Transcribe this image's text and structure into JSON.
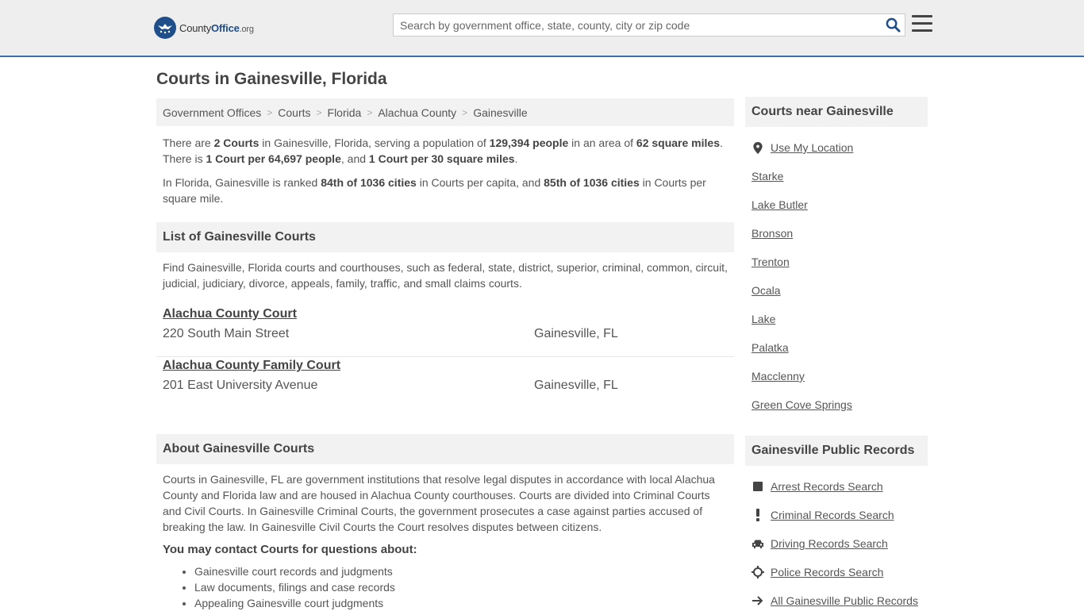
{
  "header": {
    "logo": {
      "name": "County",
      "accent": "Office",
      "tld": ".org"
    },
    "search": {
      "placeholder": "Search by government office, state, county, city or zip code",
      "value": ""
    }
  },
  "page_title": "Courts in Gainesville, Florida",
  "breadcrumb": [
    "Government Offices",
    "Courts",
    "Florida",
    "Alachua County",
    "Gainesville"
  ],
  "intro": {
    "p1": {
      "t1": "There are ",
      "b1": "2 Courts",
      "t2": " in Gainesville, Florida, serving a population of ",
      "b2": "129,394 people",
      "t3": " in an area of ",
      "b3": "62 square miles",
      "t4": ". There is ",
      "b4": "1 Court per 64,697 people",
      "t5": ", and ",
      "b5": "1 Court per 30 square miles",
      "t6": "."
    },
    "p2": {
      "t1": "In Florida, Gainesville is ranked ",
      "b1": "84th of 1036 cities",
      "t2": " in Courts per capita, and ",
      "b2": "85th of 1036 cities",
      "t3": " in Courts per square mile."
    }
  },
  "list_section": {
    "heading": "List of Gainesville Courts",
    "description": "Find Gainesville, Florida courts and courthouses, such as federal, state, district, superior, criminal, common, circuit, judicial, judiciary, divorce, appeals, family, traffic, and small claims courts.",
    "courts": [
      {
        "name": "Alachua County Court",
        "address": "220 South Main Street",
        "city": "Gainesville, FL"
      },
      {
        "name": "Alachua County Family Court",
        "address": "201 East University Avenue",
        "city": "Gainesville, FL"
      }
    ]
  },
  "about_section": {
    "heading": "About Gainesville Courts",
    "text": "Courts in Gainesville, FL are government institutions that resolve legal disputes in accordance with local Alachua County and Florida law and are housed in Alachua County courthouses. Courts are divided into Criminal Courts and Civil Courts. In Gainesville Criminal Courts, the government prosecutes a case against parties accused of breaking the law. In Gainesville Civil Courts the Court resolves disputes between citizens.",
    "contact_heading": "You may contact Courts for questions about:",
    "contact_items": [
      "Gainesville court records and judgments",
      "Law documents, filings and case records",
      "Appealing Gainesville court judgments"
    ]
  },
  "sidebar": {
    "near": {
      "heading": "Courts near Gainesville",
      "use_location": "Use My Location",
      "cities": [
        "Starke",
        "Lake Butler",
        "Bronson",
        "Trenton",
        "Ocala",
        "Lake",
        "Palatka",
        "Macclenny",
        "Green Cove Springs"
      ]
    },
    "records": {
      "heading": "Gainesville Public Records",
      "items": [
        {
          "label": "Arrest Records Search",
          "icon": "square-icon"
        },
        {
          "label": "Criminal Records Search",
          "icon": "exclamation-icon"
        },
        {
          "label": "Driving Records Search",
          "icon": "car-icon"
        },
        {
          "label": "Police Records Search",
          "icon": "crosshair-icon"
        },
        {
          "label": "All Gainesville Public Records",
          "icon": "arrow-right-icon"
        }
      ]
    }
  },
  "colors": {
    "accent": "#3a6fb0",
    "logo_blue": "#1e4f8a",
    "panel_bg": "#f2f2f2",
    "header_bg": "#eeeeee"
  }
}
